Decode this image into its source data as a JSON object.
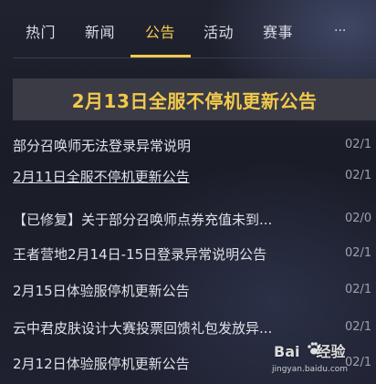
{
  "tabs": [
    {
      "label": "热门"
    },
    {
      "label": "新闻"
    },
    {
      "label": "公告"
    },
    {
      "label": "活动"
    },
    {
      "label": "赛事"
    }
  ],
  "active_tab": "公告",
  "more_label": "...",
  "banner": {
    "title": "2月13日全服不停机更新公告"
  },
  "news": [
    {
      "title": "部分召唤师无法登录异常说明",
      "date": "02/1"
    },
    {
      "title": "2月11日全服不停机更新公告",
      "date": "02/1"
    },
    {
      "title": "【已修复】关于部分召唤师点券充值未到...",
      "date": "02/0"
    },
    {
      "title": "王者营地2月14日-15日登录异常说明公告",
      "date": "02/1"
    },
    {
      "title": "2月15日体验服停机更新公告",
      "date": "02/1"
    },
    {
      "title": "云中君皮肤设计大赛投票回馈礼包发放异...",
      "date": "02/1"
    },
    {
      "title": "2月12日体验服停机更新公告",
      "date": "02/1"
    }
  ],
  "watermark": {
    "brand_a": "Bai",
    "brand_b": "经验",
    "url": "jingyan.baidu.com"
  },
  "colors": {
    "accent": "#f2c94c",
    "background": "#1b1d2a",
    "banner_bg": "#3a3b44"
  }
}
